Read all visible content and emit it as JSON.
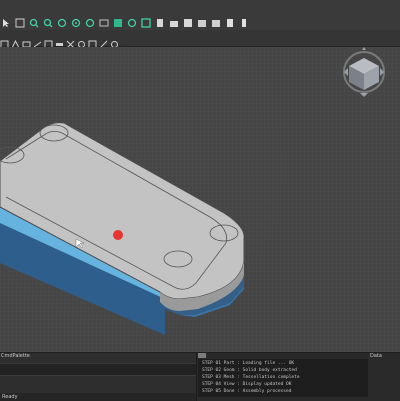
{
  "toolbar": {
    "icons": [
      "select-icon",
      "fit-view-icon",
      "zoom-in-icon",
      "zoom-out-icon",
      "rotate-icon",
      "orbit-icon",
      "pan-icon",
      "walk-icon",
      "shaded-view-icon",
      "hidden-line-icon",
      "section-icon",
      "light-icon",
      "render-icon",
      "measure-icon",
      "clip-icon",
      "layer-icon",
      "print-icon",
      "settings-icon"
    ],
    "row2_icons": [
      "view-front-icon",
      "view-top-icon",
      "view-left-icon",
      "view-iso-icon",
      "view-back-icon",
      "view-bottom-icon",
      "view-right-icon",
      "snap-icon",
      "grid-icon",
      "ortho-icon",
      "polar-icon"
    ]
  },
  "viewport": {
    "model_color": "#66b3e0",
    "model_dark_color": "#3a74a6",
    "top_face_color": "#c3c3c3",
    "point_marker_color": "#e8332e",
    "viewcube_label": ""
  },
  "command_panel": {
    "title": "CmdPalette",
    "input_placeholder": "",
    "status": "Ready"
  },
  "console": {
    "title": "Data",
    "lines": [
      "STEP 01  Part : Loading file  ... OK",
      "STEP 02  Geom : Solid body extracted",
      "STEP 03  Mesh : Tessellation complete",
      "STEP 04  View : Display updated OK",
      "STEP 05  Done : Assembly processed"
    ]
  }
}
